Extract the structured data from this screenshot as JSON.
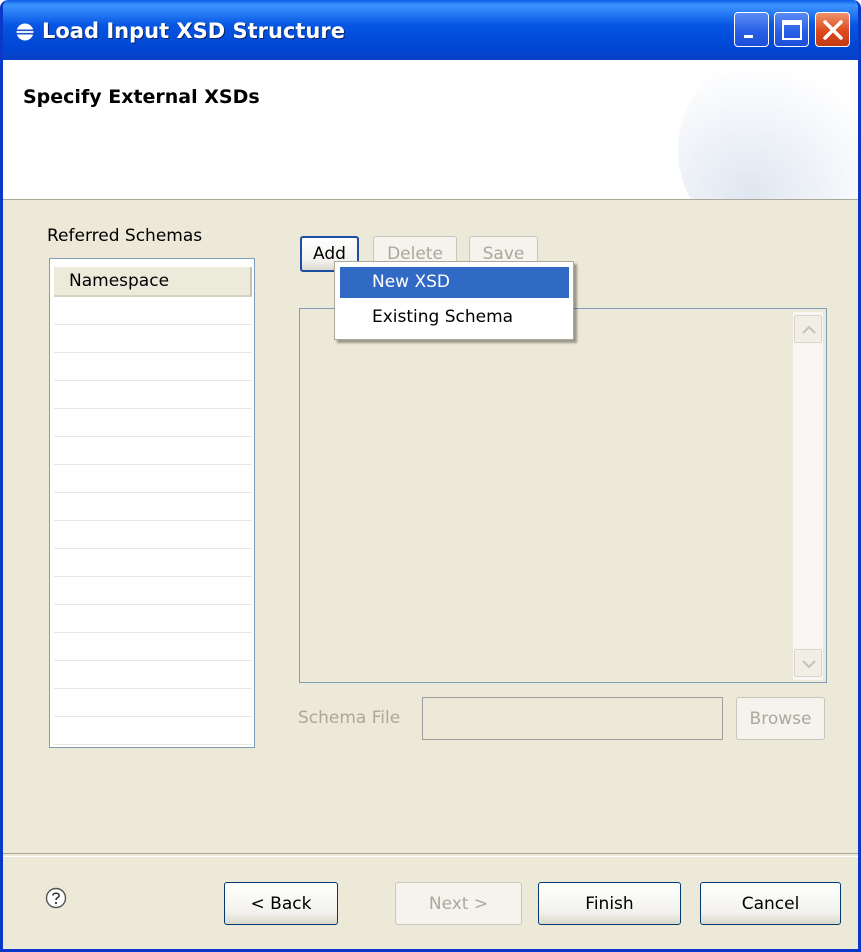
{
  "window": {
    "title": "Load Input XSD Structure",
    "banner_title": "Specify External XSDs"
  },
  "schemas": {
    "label": "Referred Schemas",
    "column_header": "Namespace",
    "rows": []
  },
  "toolbar": {
    "add": "Add",
    "delete": "Delete",
    "save": "Save"
  },
  "add_menu": {
    "items": [
      "New XSD",
      "Existing Schema"
    ],
    "selected": "New XSD"
  },
  "schema_file": {
    "label": "Schema File",
    "value": "",
    "browse": "Browse"
  },
  "footer": {
    "back": "< Back",
    "next": "Next >",
    "finish": "Finish",
    "cancel": "Cancel"
  },
  "icons": {
    "app": "eclipse-icon",
    "help": "help-icon",
    "minimize": "minimize-icon",
    "maximize": "maximize-icon",
    "close": "close-icon"
  },
  "colors": {
    "titlebar": "#0a5ee8",
    "dialog_background": "#ece9d8",
    "menu_highlight": "#316ac5",
    "close_button": "#de4a1c"
  }
}
